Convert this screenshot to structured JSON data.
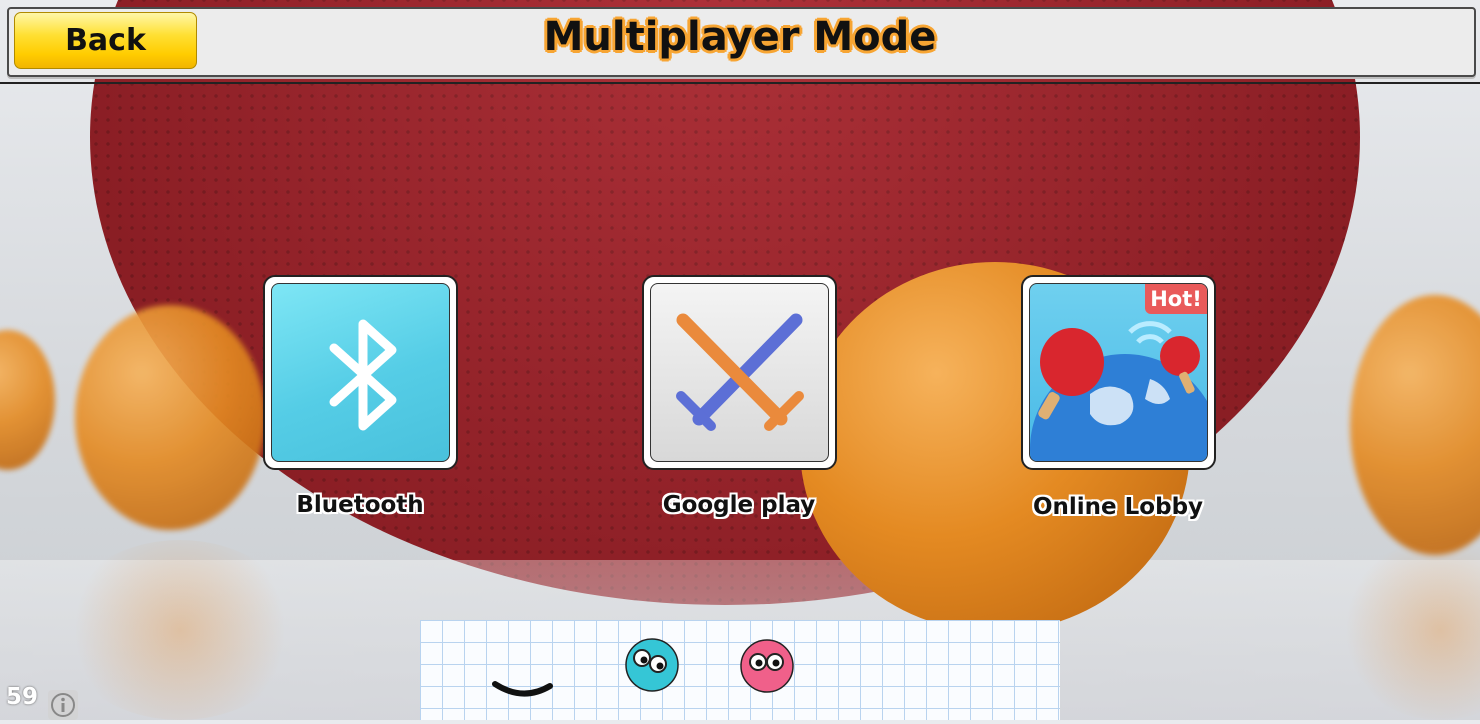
{
  "header": {
    "back_label": "Back",
    "title": "Multiplayer Mode"
  },
  "modes": [
    {
      "label": "Bluetooth",
      "icon": "bluetooth-icon"
    },
    {
      "label": "Google play",
      "icon": "crossed-swords-icon"
    },
    {
      "label": "Online Lobby",
      "icon": "globe-paddles-icon",
      "badge": "Hot!"
    }
  ],
  "status": {
    "fps": "59"
  },
  "colors": {
    "back_button": "#ffd700",
    "title_outline": "#f7a533",
    "bluetooth_tile": "#55cde6",
    "google_play_tile": "#e0e0e0",
    "online_tile": "#48b9e6",
    "hot_badge": "#e95a5a"
  }
}
